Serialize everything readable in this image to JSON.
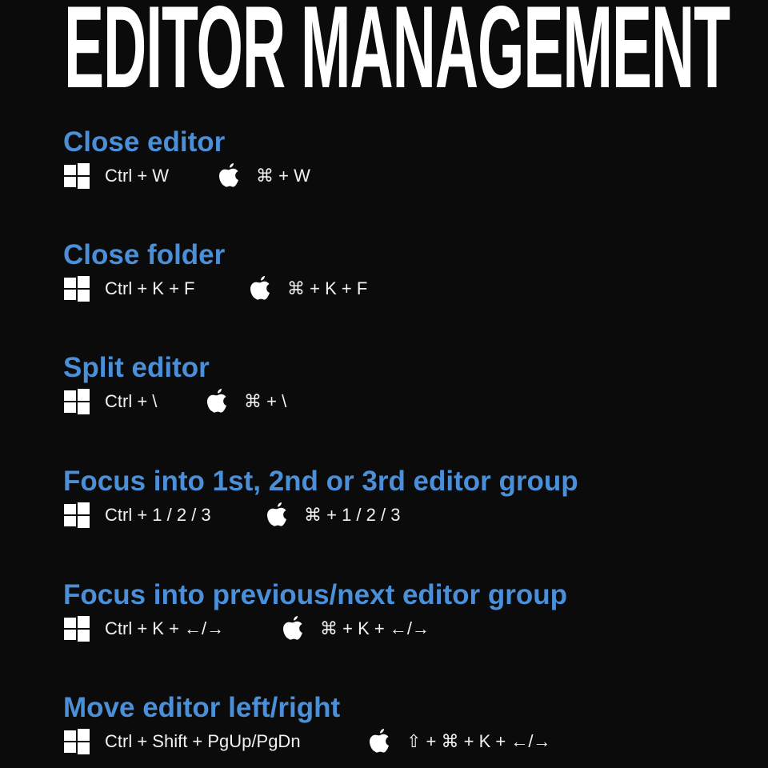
{
  "title": "EDITOR MANAGEMENT",
  "colors": {
    "heading": "#4a8fd8",
    "background": "#0b0b0b",
    "text": "#ffffff"
  },
  "icons": {
    "windows": "windows-logo-icon",
    "mac": "apple-logo-icon"
  },
  "sections": [
    {
      "heading": "Close editor",
      "windows": "Ctrl + W",
      "mac": "⌘ + W"
    },
    {
      "heading": "Close folder",
      "windows": "Ctrl + K + F",
      "mac": "⌘ + K + F"
    },
    {
      "heading": "Split editor",
      "windows": "Ctrl + \\",
      "mac": "⌘ + \\"
    },
    {
      "heading": "Focus into 1st, 2nd or 3rd editor group",
      "windows": "Ctrl + 1 / 2 / 3",
      "mac": "⌘ + 1 / 2 / 3"
    },
    {
      "heading": "Focus into previous/next editor group",
      "windows": "Ctrl + K + ←/→",
      "mac": "⌘ + K + ←/→"
    },
    {
      "heading": "Move editor left/right",
      "windows": "Ctrl + Shift + PgUp/PgDn",
      "mac": "⇧ + ⌘  + K + ←/→"
    }
  ]
}
